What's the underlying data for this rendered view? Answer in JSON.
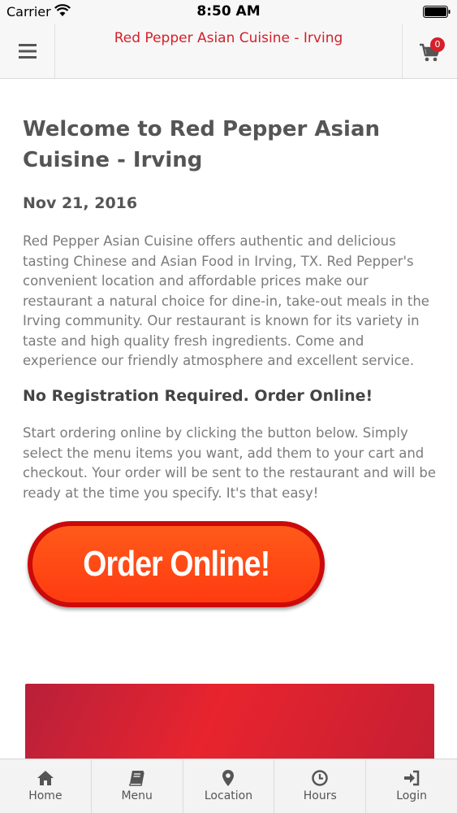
{
  "status_bar": {
    "carrier": "Carrier",
    "time": "8:50 AM"
  },
  "header": {
    "title": "Red Pepper Asian Cuisine - Irving",
    "cart_count": "0"
  },
  "main": {
    "title": "Welcome to Red Pepper Asian Cuisine - Irving",
    "date": "Nov 21, 2016",
    "intro": "Red Pepper Asian Cuisine offers authentic and delicious tasting Chinese and Asian Food in Irving, TX.  Red Pepper's convenient location and affordable prices make our restaurant a natural choice for dine-in, take-out meals in the Irving community. Our restaurant is known for its variety in taste and high quality fresh ingredients. Come and experience our friendly atmosphere and excellent service.",
    "subheading": "No Registration Required. Order Online!",
    "order_text": "Start ordering online by clicking the button below. Simply select the menu items you want, add them to your cart and checkout. Your order will be sent to the restaurant and will be ready at the time you specify. It's that easy!",
    "order_button_label": "Order Online!"
  },
  "tabs": [
    {
      "label": "Home",
      "icon": "home-icon"
    },
    {
      "label": "Menu",
      "icon": "book-icon"
    },
    {
      "label": "Location",
      "icon": "map-pin-icon"
    },
    {
      "label": "Hours",
      "icon": "clock-icon"
    },
    {
      "label": "Login",
      "icon": "login-icon"
    }
  ],
  "colors": {
    "accent": "#d4202a",
    "order_button": "#ff4010",
    "text": "#7b7b7b",
    "heading": "#555555"
  }
}
